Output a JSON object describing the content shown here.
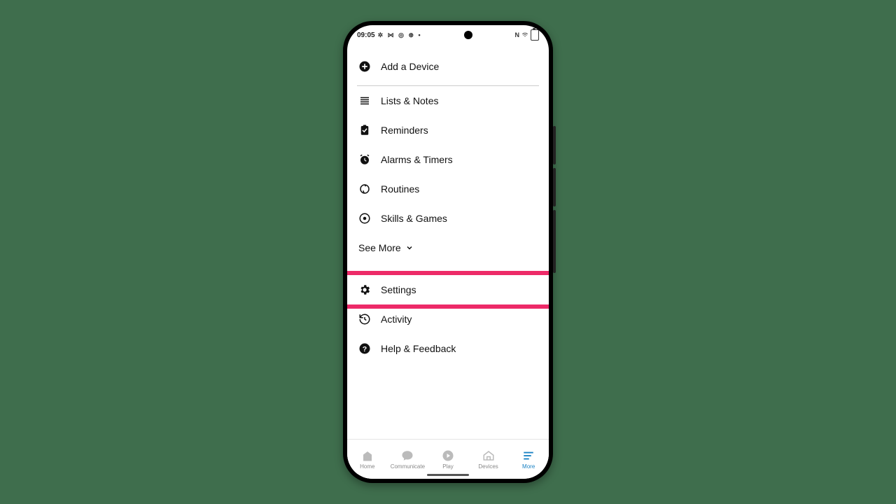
{
  "statusbar": {
    "time": "09:05",
    "left_glyphs": "✲ ⋈ ◎ ⊛ •",
    "right_n": "N",
    "right_wifi": "⋮"
  },
  "menu": {
    "add_device": "Add a Device",
    "lists_notes": "Lists & Notes",
    "reminders": "Reminders",
    "alarms_timers": "Alarms & Timers",
    "routines": "Routines",
    "skills_games": "Skills & Games",
    "see_more": "See More",
    "settings": "Settings",
    "activity": "Activity",
    "help_feedback": "Help & Feedback"
  },
  "nav": {
    "home": "Home",
    "communicate": "Communicate",
    "play": "Play",
    "devices": "Devices",
    "more": "More"
  }
}
